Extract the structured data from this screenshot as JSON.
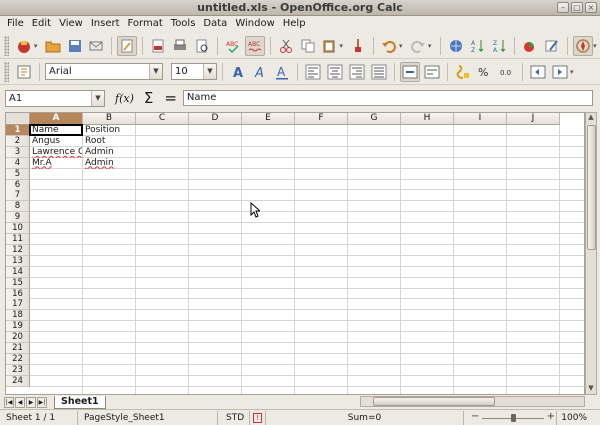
{
  "window": {
    "title": "untitled.xls - OpenOffice.org Calc"
  },
  "menu": [
    "File",
    "Edit",
    "View",
    "Insert",
    "Format",
    "Tools",
    "Data",
    "Window",
    "Help"
  ],
  "format_bar": {
    "font_name": "Arial",
    "font_size": "10"
  },
  "formula_bar": {
    "name_box": "A1",
    "fx_label": "f(x)",
    "sum_label": "Σ",
    "eq_label": "=",
    "content": "Name"
  },
  "grid": {
    "columns": [
      "A",
      "B",
      "C",
      "D",
      "E",
      "F",
      "G",
      "H",
      "I",
      "J"
    ],
    "selected_column": "A",
    "rows": [
      "1",
      "2",
      "3",
      "4",
      "5",
      "6",
      "7",
      "8",
      "9",
      "10",
      "11",
      "12",
      "13",
      "14",
      "15",
      "16",
      "17",
      "18",
      "19",
      "20",
      "21",
      "22",
      "23",
      "24"
    ],
    "selected_row": "1",
    "cells": [
      {
        "ref": "A1",
        "text": "Name",
        "spell": false
      },
      {
        "ref": "B1",
        "text": "Position",
        "spell": false
      },
      {
        "ref": "A2",
        "text": "Angus",
        "spell": false
      },
      {
        "ref": "B2",
        "text": "Root",
        "spell": false
      },
      {
        "ref": "A3",
        "text": "Lawrence Chen",
        "spell": true
      },
      {
        "ref": "B3",
        "text": "Admin",
        "spell": false
      },
      {
        "ref": "A4",
        "text": "Mr.A",
        "spell": true
      },
      {
        "ref": "B4",
        "text": "Admin",
        "spell": true
      }
    ]
  },
  "sheets": {
    "active": "Sheet1"
  },
  "status": {
    "sheet": "Sheet 1 / 1",
    "page_style": "PageStyle_Sheet1",
    "mode": "STD",
    "sum": "Sum=0",
    "zoom": "100%",
    "zoom_level": 0.5
  },
  "colors": {
    "selected_header": "#b5875b",
    "grid_line": "#d9d5cf",
    "chrome": "#ede9e3"
  }
}
